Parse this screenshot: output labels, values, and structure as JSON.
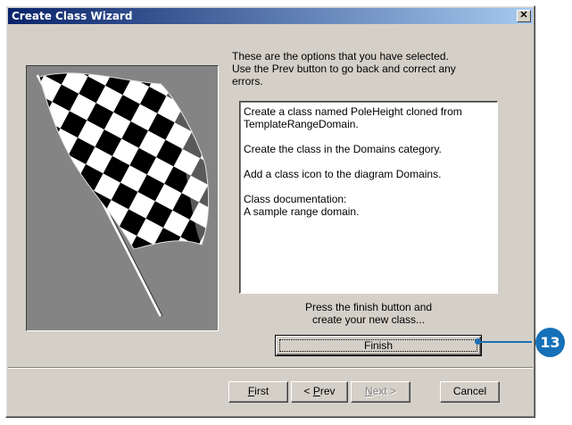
{
  "window": {
    "title": "Create Class Wizard",
    "close_glyph": "✕"
  },
  "intro": {
    "lines": [
      "These are the options that you have selected.",
      "Use the Prev button to go back and correct any",
      "errors."
    ]
  },
  "summary": {
    "p1": [
      "Create a class named PoleHeight cloned from",
      "TemplateRangeDomain."
    ],
    "p2": [
      "Create the class in the Domains category."
    ],
    "p3": [
      "Add a class icon to the diagram Domains."
    ],
    "p4": [
      "Class documentation:",
      "A sample range domain."
    ]
  },
  "finish_prompt": [
    "Press the finish button and",
    "create your new class..."
  ],
  "buttons": {
    "finish": "Finish",
    "first": {
      "underline": "F",
      "rest": "irst"
    },
    "prev": {
      "pre": "< ",
      "underline": "P",
      "rest": "rev"
    },
    "next": {
      "underline": "N",
      "rest": "ext >"
    },
    "cancel": "Cancel"
  },
  "callout": {
    "number": "13"
  },
  "image": {
    "icon": "checkered-flag-icon"
  },
  "colors": {
    "title_bar_start": "#0a246a",
    "title_bar_end": "#a6caf0",
    "dialog_face": "#d4d0c8",
    "callout": "#1570b8"
  }
}
